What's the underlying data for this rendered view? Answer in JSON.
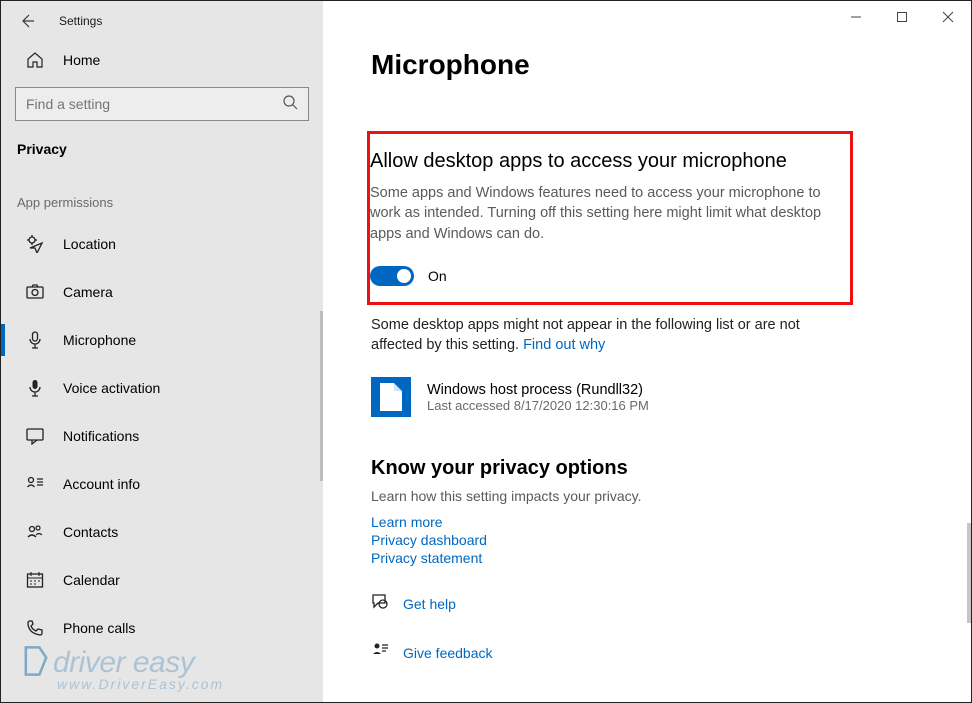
{
  "window": {
    "title": "Settings"
  },
  "sidebar": {
    "home": "Home",
    "search_placeholder": "Find a setting",
    "category": "Privacy",
    "section": "App permissions",
    "items": [
      {
        "label": "Location",
        "icon": "location-icon"
      },
      {
        "label": "Camera",
        "icon": "camera-icon"
      },
      {
        "label": "Microphone",
        "icon": "microphone-icon",
        "selected": true
      },
      {
        "label": "Voice activation",
        "icon": "voice-icon"
      },
      {
        "label": "Notifications",
        "icon": "notification-icon"
      },
      {
        "label": "Account info",
        "icon": "account-icon"
      },
      {
        "label": "Contacts",
        "icon": "contacts-icon"
      },
      {
        "label": "Calendar",
        "icon": "calendar-icon"
      },
      {
        "label": "Phone calls",
        "icon": "phone-icon"
      }
    ]
  },
  "main": {
    "page_title": "Microphone",
    "allow": {
      "heading": "Allow desktop apps to access your microphone",
      "desc": "Some apps and Windows features need to access your microphone to work as intended. Turning off this setting here might limit what desktop apps and Windows can do.",
      "toggle_state": "On"
    },
    "note_prefix": "Some desktop apps might not appear in the following list or are not affected by this setting. ",
    "note_link": "Find out why",
    "app": {
      "name": "Windows host process (Rundll32)",
      "last": "Last accessed 8/17/2020 12:30:16 PM"
    },
    "privacy": {
      "heading": "Know your privacy options",
      "desc": "Learn how this setting impacts your privacy.",
      "links": [
        "Learn more",
        "Privacy dashboard",
        "Privacy statement"
      ]
    },
    "help": {
      "get_help": "Get help",
      "feedback": "Give feedback"
    }
  },
  "watermark": {
    "brand": "driver easy",
    "url": "www.DriverEasy.com"
  }
}
